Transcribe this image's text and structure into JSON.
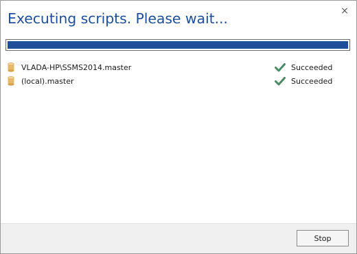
{
  "dialog": {
    "title": "Executing scripts. Please wait...",
    "close_glyph": "×"
  },
  "progress": {
    "fraction": 1.0,
    "fill_color": "#1f4f9a"
  },
  "results": [
    {
      "icon": "database-icon",
      "name": "VLADA-HP\\SSMS2014.master",
      "status_icon": "check-icon",
      "status": "Succeeded"
    },
    {
      "icon": "database-icon",
      "name": "(local).master",
      "status_icon": "check-icon",
      "status": "Succeeded"
    }
  ],
  "footer": {
    "stop_label": "Stop"
  },
  "colors": {
    "title": "#1f4e9a",
    "success": "#4a8a66",
    "database": "#e6b86a"
  }
}
